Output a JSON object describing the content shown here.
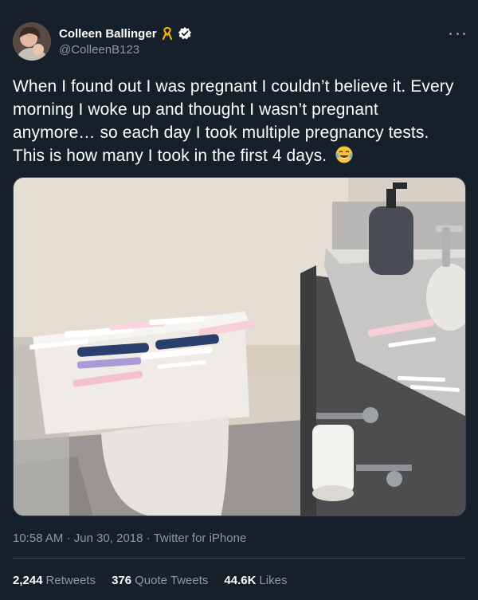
{
  "author": {
    "display_name": "Colleen Ballinger",
    "handle": "@ColleenB123",
    "ribbon_icon": "ribbon-icon",
    "verified_icon": "verified-badge-icon"
  },
  "tweet": {
    "text": "When I found out I was pregnant I couldn’t believe it. Every morning I woke up and thought I wasn’t pregnant anymore… so each day I took multiple pregnancy tests. This is how many I took in the first 4 days.",
    "emoji": "face-with-tears-of-joy-icon"
  },
  "meta": {
    "time": "10:58 AM",
    "date": "Jun 30, 2018",
    "source": "Twitter for iPhone",
    "separator": "·"
  },
  "stats": [
    {
      "count": "2,244",
      "label": "Retweets"
    },
    {
      "count": "376",
      "label": "Quote Tweets"
    },
    {
      "count": "44.6K",
      "label": "Likes"
    }
  ],
  "colors": {
    "background": "#15202b",
    "text_primary": "#ffffff",
    "text_secondary": "#8b98a5",
    "border": "#38444d",
    "ribbon": "#f4b400",
    "verified": "#ffffff"
  }
}
